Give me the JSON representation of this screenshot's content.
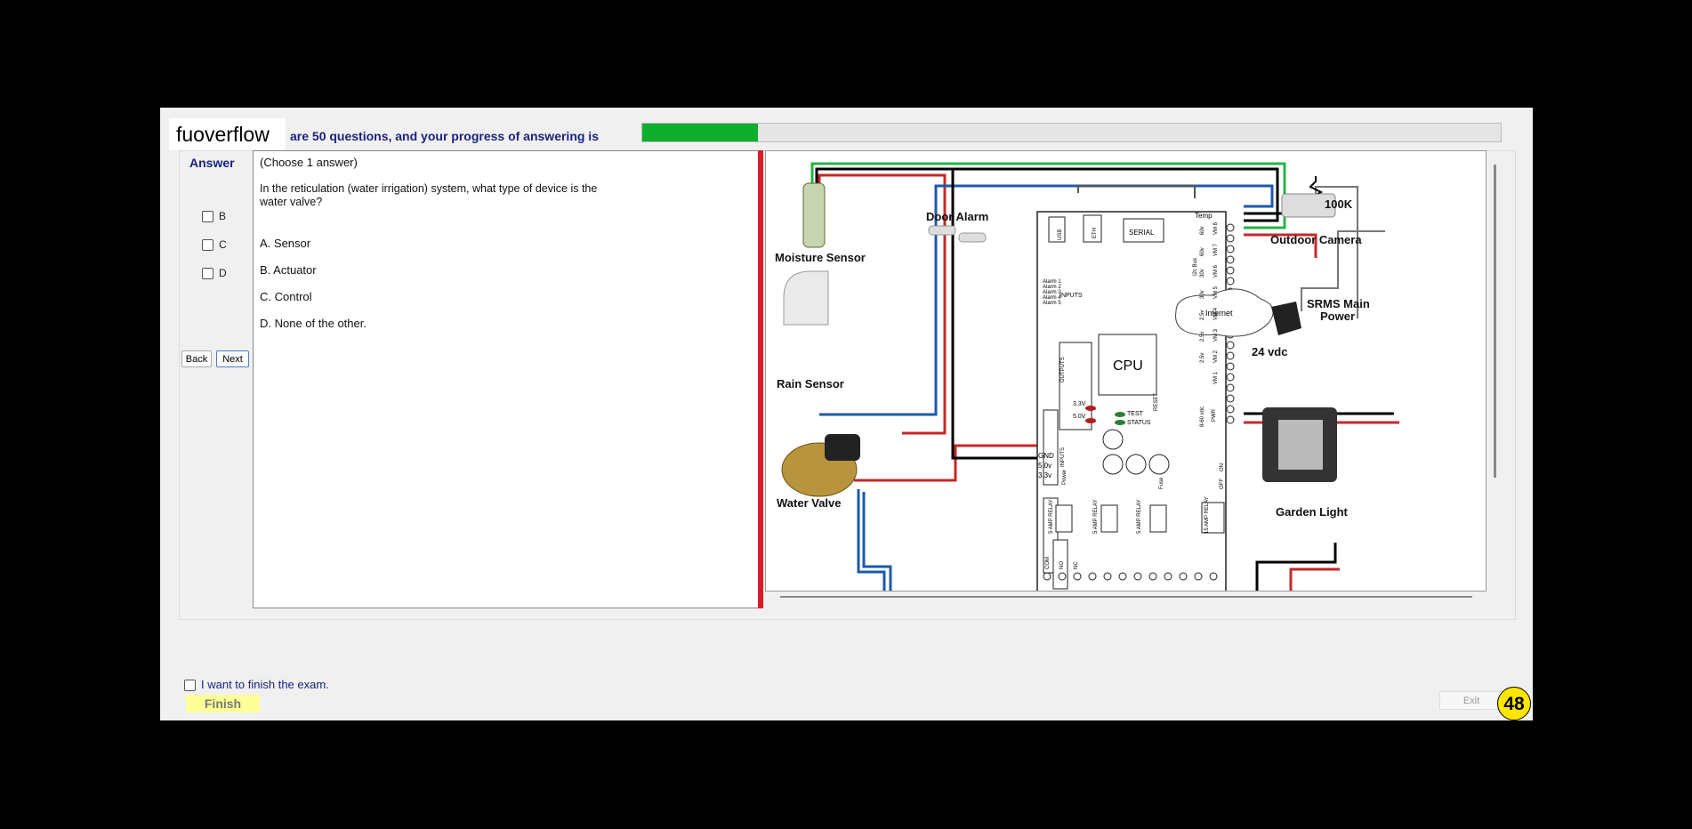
{
  "header": {
    "brand": "fuoverflow",
    "progress_text": "are 50 questions, and your progress of answering is",
    "progress_fraction": 0.135
  },
  "answer": {
    "title": "Answer",
    "options": [
      "B",
      "C",
      "D"
    ],
    "back_label": "Back",
    "next_label": "Next"
  },
  "question": {
    "instruction": "(Choose 1 answer)",
    "text_line1": "In the reticulation  (water irrigation) system, what type of device is the",
    "text_line2": "water valve?",
    "choices": [
      "A. Sensor",
      "B. Actuator",
      "C. Control",
      "D.  None of the other."
    ]
  },
  "diagram": {
    "labels": {
      "moisture": "Moisture Sensor",
      "rain": "Rain Sensor",
      "valve": "Water Valve",
      "door": "Door Alarm",
      "camera": "Outdoor Camera",
      "srms_1": "SRMS Main",
      "srms_2": "Power",
      "vdc": "24 vdc",
      "garden": "Garden Light",
      "resistor": "100K",
      "internet": "Internet",
      "cpu": "CPU",
      "usb": "USB",
      "eth": "ETH",
      "serial": "SERIAL",
      "inputs": "INPUTS",
      "outputs": "OUTPUTS",
      "inputs2": "INPUTS",
      "reset": "RESET",
      "test": "TEST",
      "status": "STATUS",
      "v33": "3.3V",
      "v50": "5.0V",
      "gnd": "GND",
      "p50": "5.0v",
      "p33": "3.3v",
      "power": "Power",
      "temp": "Temp",
      "fuse": "Fuse",
      "relay1": "5 AMP RELAY",
      "relay2": "5 AMP RELAY",
      "relay3": "5 AMP RELAY",
      "relay4": "15 AMP RELAY",
      "i2c": "I2c Bus",
      "off": "OFF",
      "on": "ON",
      "pwr": "PWR",
      "alarm1": "Alarm 1",
      "alarm2": "Alarm 2",
      "alarm3": "Alarm 3",
      "alarm4": "Alarm 4",
      "alarm5": "Alarm 5",
      "vm8": "VM 8",
      "vm7": "VM 7",
      "vm6": "VM 6",
      "vm5": "VM 5",
      "vm4": "VM 4",
      "vm3": "VM 3",
      "vm2": "VM 2",
      "vm1": "VM 1",
      "v60a": "60v",
      "v60b": "60v",
      "v30a": "30v",
      "v30b": "30v",
      "v25a": "2.5v",
      "v25b": "2.5v",
      "v25c": "2.5v",
      "v860": "8-60 vdc",
      "com": "COM",
      "no": "NO",
      "nc": "NC"
    }
  },
  "footer": {
    "finish_check": "I want to finish the exam.",
    "finish_label": "Finish",
    "exit_label": "Exit",
    "badge": "48"
  },
  "colors": {
    "progress": "#0fae2c",
    "red_bar": "#d32027",
    "header_text": "#1a237e",
    "finish_bg": "#ffff99",
    "badge": "#ffe600"
  }
}
